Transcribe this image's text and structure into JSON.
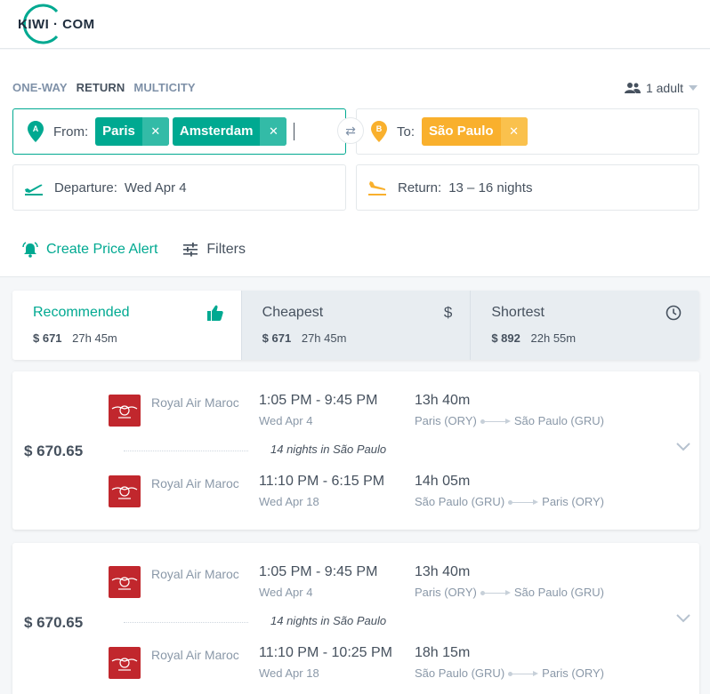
{
  "brand": {
    "logo_text": "KIWI · COM"
  },
  "trip_types": [
    "ONE-WAY",
    "RETURN",
    "MULTICITY"
  ],
  "active_trip_type": "RETURN",
  "passengers": {
    "label": "1 adult"
  },
  "from": {
    "label": "From:",
    "chips": [
      "Paris",
      "Amsterdam"
    ],
    "marker": "A"
  },
  "to": {
    "label": "To:",
    "chips": [
      "São Paulo"
    ],
    "marker": "B"
  },
  "departure": {
    "label": "Departure:",
    "value": "Wed Apr 4"
  },
  "return": {
    "label": "Return:",
    "value": "13 – 16 nights"
  },
  "actions": {
    "price_alert": "Create Price Alert",
    "filters": "Filters"
  },
  "sort_tabs": [
    {
      "title": "Recommended",
      "price": "$ 671",
      "duration": "27h 45m",
      "icon": "thumbs-up-icon"
    },
    {
      "title": "Cheapest",
      "price": "$ 671",
      "duration": "27h 45m",
      "icon": "dollar-icon"
    },
    {
      "title": "Shortest",
      "price": "$ 892",
      "duration": "22h 55m",
      "icon": "clock-icon"
    }
  ],
  "results": [
    {
      "price": "$ 670.65",
      "nights": "14 nights in São Paulo",
      "outbound": {
        "airline": "Royal Air Maroc",
        "times": "1:05 PM - 9:45 PM",
        "date": "Wed Apr 4",
        "duration": "13h 40m",
        "from": "Paris (ORY)",
        "to": "São Paulo (GRU)"
      },
      "inbound": {
        "airline": "Royal Air Maroc",
        "times": "11:10 PM - 6:15 PM",
        "date": "Wed Apr 18",
        "duration": "14h 05m",
        "from": "São Paulo (GRU)",
        "to": "Paris (ORY)"
      }
    },
    {
      "price": "$ 670.65",
      "nights": "14 nights in São Paulo",
      "outbound": {
        "airline": "Royal Air Maroc",
        "times": "1:05 PM - 9:45 PM",
        "date": "Wed Apr 4",
        "duration": "13h 40m",
        "from": "Paris (ORY)",
        "to": "São Paulo (GRU)"
      },
      "inbound": {
        "airline": "Royal Air Maroc",
        "times": "11:10 PM - 10:25 PM",
        "date": "Wed Apr 18",
        "duration": "18h 15m",
        "from": "São Paulo (GRU)",
        "to": "Paris (ORY)"
      }
    }
  ],
  "colors": {
    "accent": "#00a991",
    "destination": "#f9b02d",
    "airline": "#c1272d",
    "text": "#46515e",
    "muted": "#8a98a8"
  }
}
